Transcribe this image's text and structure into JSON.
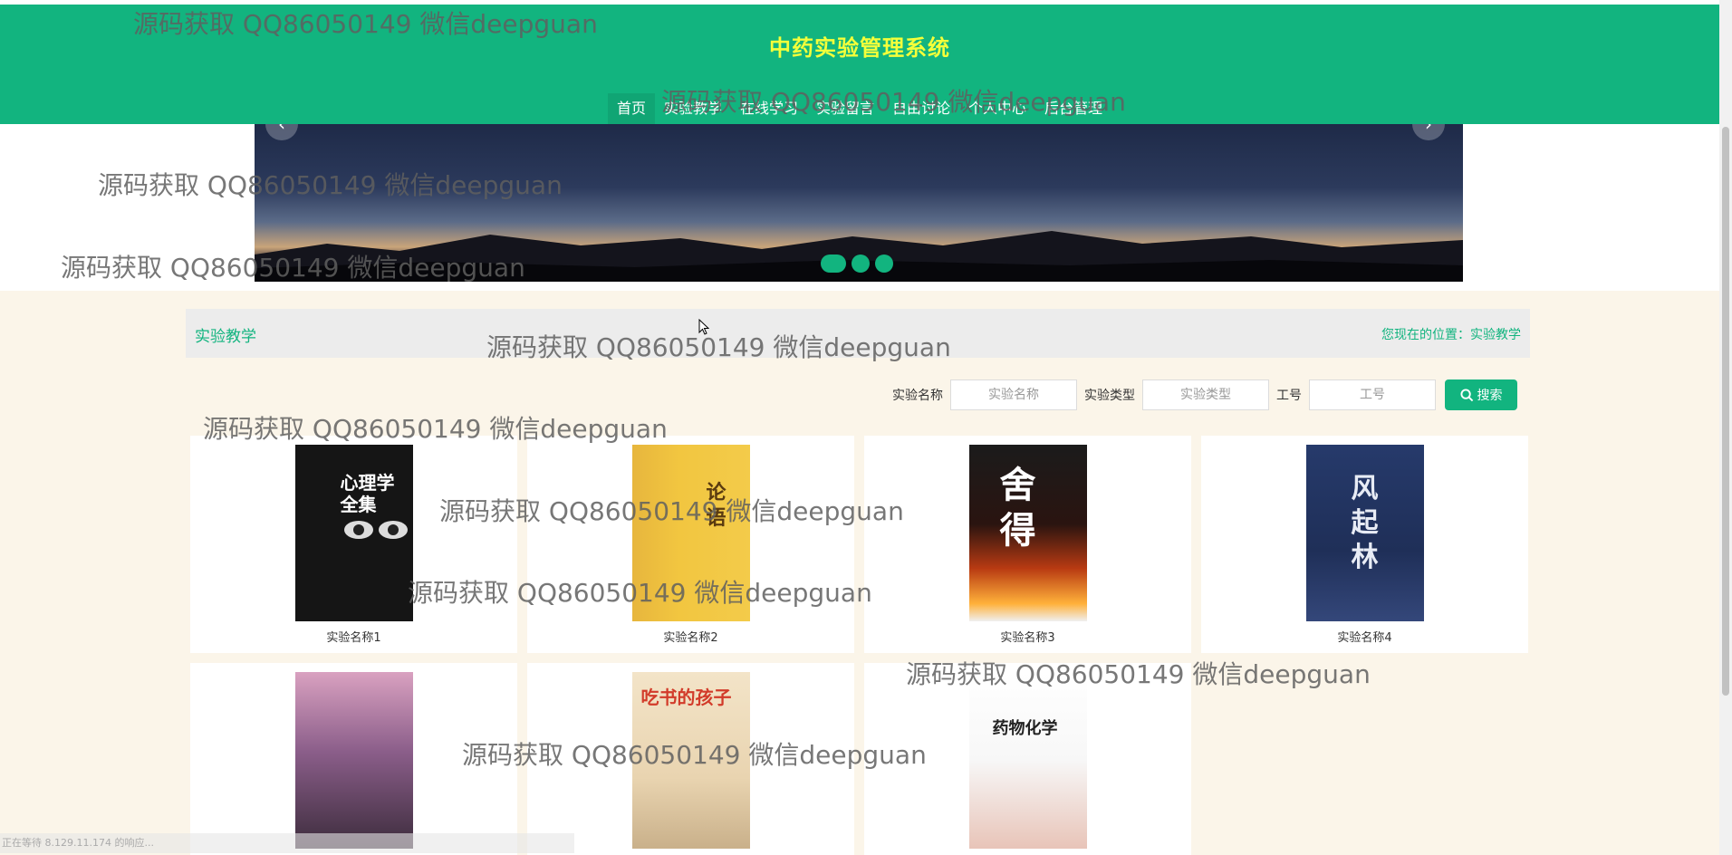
{
  "header": {
    "title": "中药实验管理系统",
    "nav": [
      {
        "label": "首页",
        "active": true
      },
      {
        "label": "实验教学",
        "active": false
      },
      {
        "label": "在线学习",
        "active": false
      },
      {
        "label": "实验留言",
        "active": false
      },
      {
        "label": "自由讨论",
        "active": false
      },
      {
        "label": "个人中心",
        "active": false
      },
      {
        "label": "后台管理",
        "active": false
      }
    ]
  },
  "banner": {
    "prev_icon": "‹",
    "next_icon": "›"
  },
  "section": {
    "title": "实验教学",
    "location_label": "您现在的位置：实验教学"
  },
  "search": {
    "name_label": "实验名称",
    "name_placeholder": "实验名称",
    "type_label": "实验类型",
    "type_placeholder": "实验类型",
    "id_label": "工号",
    "id_placeholder": "工号",
    "button_label": "搜索"
  },
  "cards": [
    {
      "name": "实验名称1",
      "cover_text": "心理学全集"
    },
    {
      "name": "实验名称2",
      "cover_text": "论语"
    },
    {
      "name": "实验名称3",
      "cover_text": "舍得"
    },
    {
      "name": "实验名称4",
      "cover_text": "风起林"
    },
    {
      "name": "",
      "cover_text": ""
    },
    {
      "name": "",
      "cover_text": "吃书的孩子"
    },
    {
      "name": "",
      "cover_text": "药物化学"
    }
  ],
  "watermark": "源码获取 QQ86050149 微信deepguan",
  "status_text": "正在等待 8.129.11.174 的响应...",
  "colors": {
    "primary": "#12b47f",
    "title_yellow": "#f4ff3a",
    "content_bg": "#fbf5e9"
  }
}
